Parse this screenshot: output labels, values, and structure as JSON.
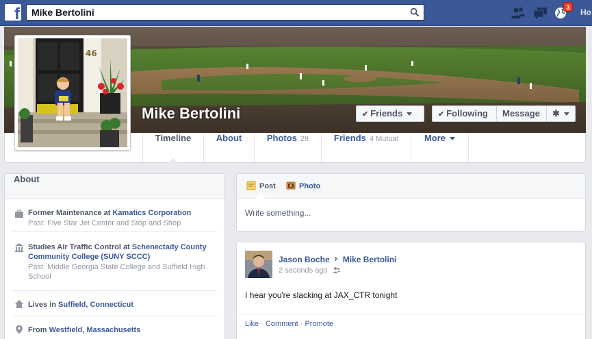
{
  "header": {
    "logo_letter": "f",
    "search": {
      "value": "Mike Bertolini"
    },
    "notifications_count": "3",
    "home_label": "Ho",
    "icons": [
      "facebook-logo",
      "search-icon",
      "friend-requests-icon",
      "messages-icon",
      "notifications-globe-icon"
    ]
  },
  "profile": {
    "name": "Mike Bertolini",
    "picture_number": "46",
    "buttons": {
      "friends": "Friends",
      "following": "Following",
      "message": "Message",
      "settings_icon": "gear-icon"
    },
    "tabs": [
      {
        "label": "Timeline",
        "count": ""
      },
      {
        "label": "About",
        "count": ""
      },
      {
        "label": "Photos",
        "count": "29"
      },
      {
        "label": "Friends",
        "count": "4 Mutual"
      },
      {
        "label": "More",
        "count": ""
      }
    ]
  },
  "about": {
    "title": "About",
    "work": {
      "prefix": "Former Maintenance at ",
      "link": "Kamatics Corporation",
      "sub": "Past: Five Star Jet Center and Stop and Shop"
    },
    "education": {
      "prefix": "Studies Air Traffic Control at ",
      "link": "Schenectady County Community College (SUNY SCCC)",
      "sub": "Past: Middle Georgia State College and Suffield High School"
    },
    "lives": {
      "prefix": "Lives in ",
      "link": "Suffield, Connecticut"
    },
    "from": {
      "prefix": "From ",
      "link": "Westfield, Massachusetts"
    }
  },
  "composer": {
    "post_label": "Post",
    "photo_label": "Photo",
    "placeholder": "Write something..."
  },
  "story": {
    "author": "Jason Boche",
    "target": "Mike Bertolini",
    "time": "2 seconds ago",
    "text": "I hear you're slacking at JAX_CTR tonight",
    "actions": {
      "like": "Like",
      "comment": "Comment",
      "promote": "Promote",
      "separator": " · "
    }
  },
  "colors": {
    "brand": "#3b5998",
    "background": "#e9eaed",
    "badge": "#f03d25"
  }
}
